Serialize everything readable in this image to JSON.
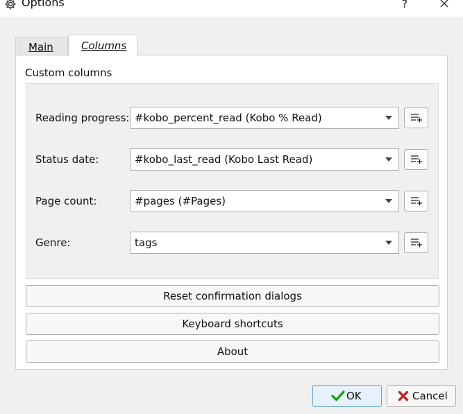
{
  "window": {
    "title": "Options",
    "help": "?"
  },
  "tabs": [
    {
      "label": "Main",
      "selected": false
    },
    {
      "label": "Columns",
      "selected": true
    }
  ],
  "custom_columns": {
    "title": "Custom columns",
    "rows": [
      {
        "label": "Reading progress:",
        "value": "#kobo_percent_read (Kobo % Read)"
      },
      {
        "label": "Status date:",
        "value": "#kobo_last_read (Kobo Last Read)"
      },
      {
        "label": "Page count:",
        "value": "#pages (#Pages)"
      },
      {
        "label": "Genre:",
        "value": "tags"
      }
    ]
  },
  "buttons": {
    "reset": "Reset confirmation dialogs",
    "keyboard": "Keyboard shortcuts",
    "about": "About",
    "ok": "OK",
    "cancel": "Cancel"
  },
  "colors": {
    "ok_check": "#1a9a1a",
    "cancel_x": "#c0282a",
    "accent_border": "#6aa4d8"
  }
}
